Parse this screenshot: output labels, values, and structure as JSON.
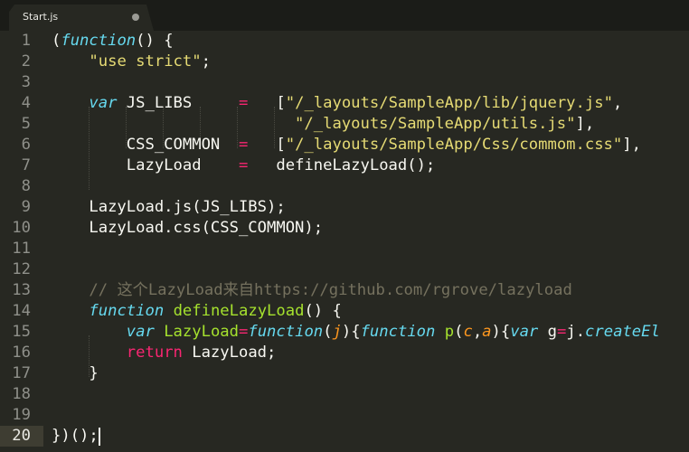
{
  "tab": {
    "title": "Start.js"
  },
  "line_numbers": [
    "1",
    "2",
    "3",
    "4",
    "5",
    "6",
    "7",
    "8",
    "9",
    "10",
    "11",
    "12",
    "13",
    "14",
    "15",
    "16",
    "17",
    "18",
    "19",
    "20"
  ],
  "current_line": "20",
  "colors": {
    "background": "#272822",
    "keyword": "#66d9ef",
    "string": "#e6db74",
    "operator": "#f92672",
    "function": "#a6e22e",
    "parameter": "#fd971f",
    "comment": "#75715e"
  },
  "code": [
    [
      [
        "pl",
        "("
      ],
      [
        "kw",
        "function"
      ],
      [
        "pl",
        "() {"
      ]
    ],
    [
      [
        "pl",
        "    "
      ],
      [
        "st",
        "\"use strict\""
      ],
      [
        "pl",
        ";"
      ]
    ],
    [],
    [
      [
        "pl",
        "    "
      ],
      [
        "kw",
        "var"
      ],
      [
        "pl",
        " JS_LIBS     "
      ],
      [
        "op",
        "="
      ],
      [
        "pl",
        "   ["
      ],
      [
        "st",
        "\"/_layouts/SampleApp/lib/jquery.js\""
      ],
      [
        "pl",
        ","
      ]
    ],
    [
      [
        "pl",
        "                          "
      ],
      [
        "st",
        "\"/_layouts/SampleApp/utils.js\""
      ],
      [
        "pl",
        "],"
      ]
    ],
    [
      [
        "pl",
        "        CSS_COMMON  "
      ],
      [
        "op",
        "="
      ],
      [
        "pl",
        "   ["
      ],
      [
        "st",
        "\"/_layouts/SampleApp/Css/commom.css\""
      ],
      [
        "pl",
        "],"
      ]
    ],
    [
      [
        "pl",
        "        LazyLoad    "
      ],
      [
        "op",
        "="
      ],
      [
        "pl",
        "   defineLazyLoad();"
      ]
    ],
    [],
    [
      [
        "pl",
        "    LazyLoad.js(JS_LIBS);"
      ]
    ],
    [
      [
        "pl",
        "    LazyLoad.css(CSS_COMMON);"
      ]
    ],
    [],
    [],
    [
      [
        "pl",
        "    "
      ],
      [
        "cm",
        "// 这个LazyLoad来自https://github.com/rgrove/lazyload"
      ]
    ],
    [
      [
        "pl",
        "    "
      ],
      [
        "kw",
        "function"
      ],
      [
        "pl",
        " "
      ],
      [
        "fn",
        "defineLazyLoad"
      ],
      [
        "pl",
        "() {"
      ]
    ],
    [
      [
        "pl",
        "        "
      ],
      [
        "kw",
        "var"
      ],
      [
        "pl",
        " "
      ],
      [
        "fn",
        "LazyLoad"
      ],
      [
        "op",
        "="
      ],
      [
        "kw",
        "function"
      ],
      [
        "pl",
        "("
      ],
      [
        "pa",
        "j"
      ],
      [
        "pl",
        "){"
      ],
      [
        "kw",
        "function"
      ],
      [
        "pl",
        " "
      ],
      [
        "fn",
        "p"
      ],
      [
        "pl",
        "("
      ],
      [
        "pa",
        "c"
      ],
      [
        "pl",
        ","
      ],
      [
        "pa",
        "a"
      ],
      [
        "pl",
        "){"
      ],
      [
        "kw",
        "var"
      ],
      [
        "pl",
        " g"
      ],
      [
        "op",
        "="
      ],
      [
        "pl",
        "j."
      ],
      [
        "kw",
        "createEl"
      ]
    ],
    [
      [
        "pl",
        "        "
      ],
      [
        "op",
        "return"
      ],
      [
        "pl",
        " LazyLoad;"
      ]
    ],
    [
      [
        "pl",
        "    }"
      ]
    ],
    [],
    [],
    [
      [
        "pl",
        "})();"
      ]
    ]
  ]
}
